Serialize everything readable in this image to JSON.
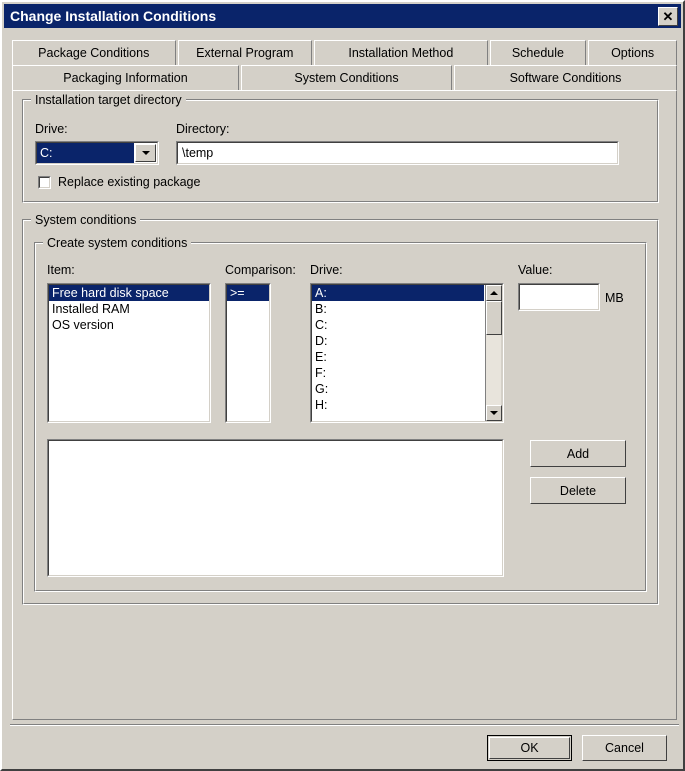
{
  "window": {
    "title": "Change Installation Conditions",
    "close_label": "✕"
  },
  "tabs": {
    "row1": [
      {
        "label": "Package Conditions",
        "active": false
      },
      {
        "label": "External Program",
        "active": false
      },
      {
        "label": "Installation Method",
        "active": false
      },
      {
        "label": "Schedule",
        "active": false
      },
      {
        "label": "Options",
        "active": false
      }
    ],
    "row2": [
      {
        "label": "Packaging Information",
        "active": false
      },
      {
        "label": "System Conditions",
        "active": true
      },
      {
        "label": "Software Conditions",
        "active": false
      }
    ]
  },
  "install_target": {
    "group_title": "Installation target directory",
    "drive_label": "Drive:",
    "drive_value": "C:",
    "directory_label": "Directory:",
    "directory_value": "\\temp",
    "replace_checkbox_label": "Replace existing package",
    "replace_checked": false
  },
  "system_conditions": {
    "group_title": "System conditions",
    "create_group_title": "Create system conditions",
    "item_label": "Item:",
    "items": [
      {
        "label": "Free hard disk space",
        "selected": true
      },
      {
        "label": "Installed RAM",
        "selected": false
      },
      {
        "label": "OS version",
        "selected": false
      }
    ],
    "comparison_label": "Comparison:",
    "comparisons": [
      {
        "label": ">=",
        "selected": true
      }
    ],
    "drive_label": "Drive:",
    "drives": [
      {
        "label": "A:",
        "selected": true
      },
      {
        "label": "B:",
        "selected": false
      },
      {
        "label": "C:",
        "selected": false
      },
      {
        "label": "D:",
        "selected": false
      },
      {
        "label": "E:",
        "selected": false
      },
      {
        "label": "F:",
        "selected": false
      },
      {
        "label": "G:",
        "selected": false
      },
      {
        "label": "H:",
        "selected": false
      }
    ],
    "value_label": "Value:",
    "value_input": "",
    "value_unit": "MB",
    "conditions_list": [],
    "add_button": "Add",
    "delete_button": "Delete"
  },
  "footer": {
    "ok_label": "OK",
    "cancel_label": "Cancel"
  },
  "colors": {
    "dialog_face": "#d4d0c8",
    "titlebar": "#0a246a",
    "selection": "#0a246a",
    "field_bg": "#ffffff"
  }
}
